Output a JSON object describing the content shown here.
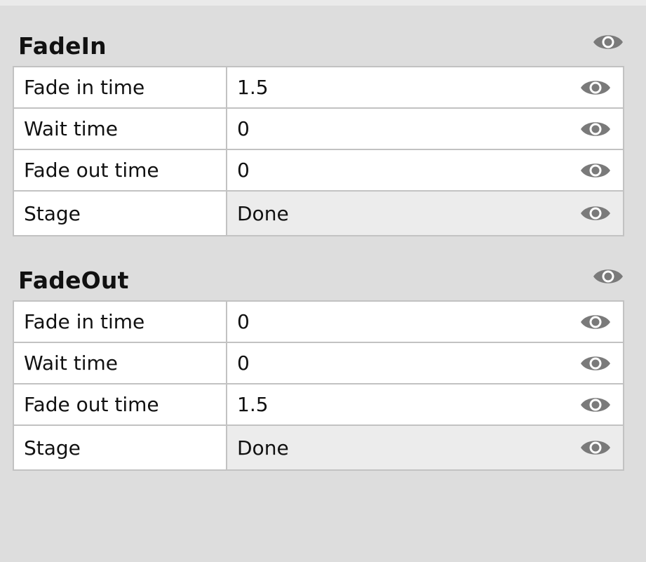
{
  "sections": [
    {
      "title": "FadeIn",
      "visibility_icon": "eye-icon",
      "rows": [
        {
          "name": "Fade in time",
          "value": "1.5",
          "icon": "eye-icon"
        },
        {
          "name": "Wait time",
          "value": "0",
          "icon": "eye-icon"
        },
        {
          "name": "Fade out time",
          "value": "0",
          "icon": "eye-icon"
        },
        {
          "name": "Stage",
          "value": "Done",
          "icon": "eye-icon",
          "readonly": true
        }
      ]
    },
    {
      "title": "FadeOut",
      "visibility_icon": "eye-icon",
      "rows": [
        {
          "name": "Fade in time",
          "value": "0",
          "icon": "eye-icon"
        },
        {
          "name": "Wait time",
          "value": "0",
          "icon": "eye-icon"
        },
        {
          "name": "Fade out time",
          "value": "1.5",
          "icon": "eye-icon"
        },
        {
          "name": "Stage",
          "value": "Done",
          "icon": "eye-icon",
          "readonly": true
        }
      ]
    }
  ],
  "colors": {
    "background": "#dddddd",
    "icon": "#7a7a7a",
    "border": "#c2c2c2",
    "readonly_cell": "#ececec"
  }
}
